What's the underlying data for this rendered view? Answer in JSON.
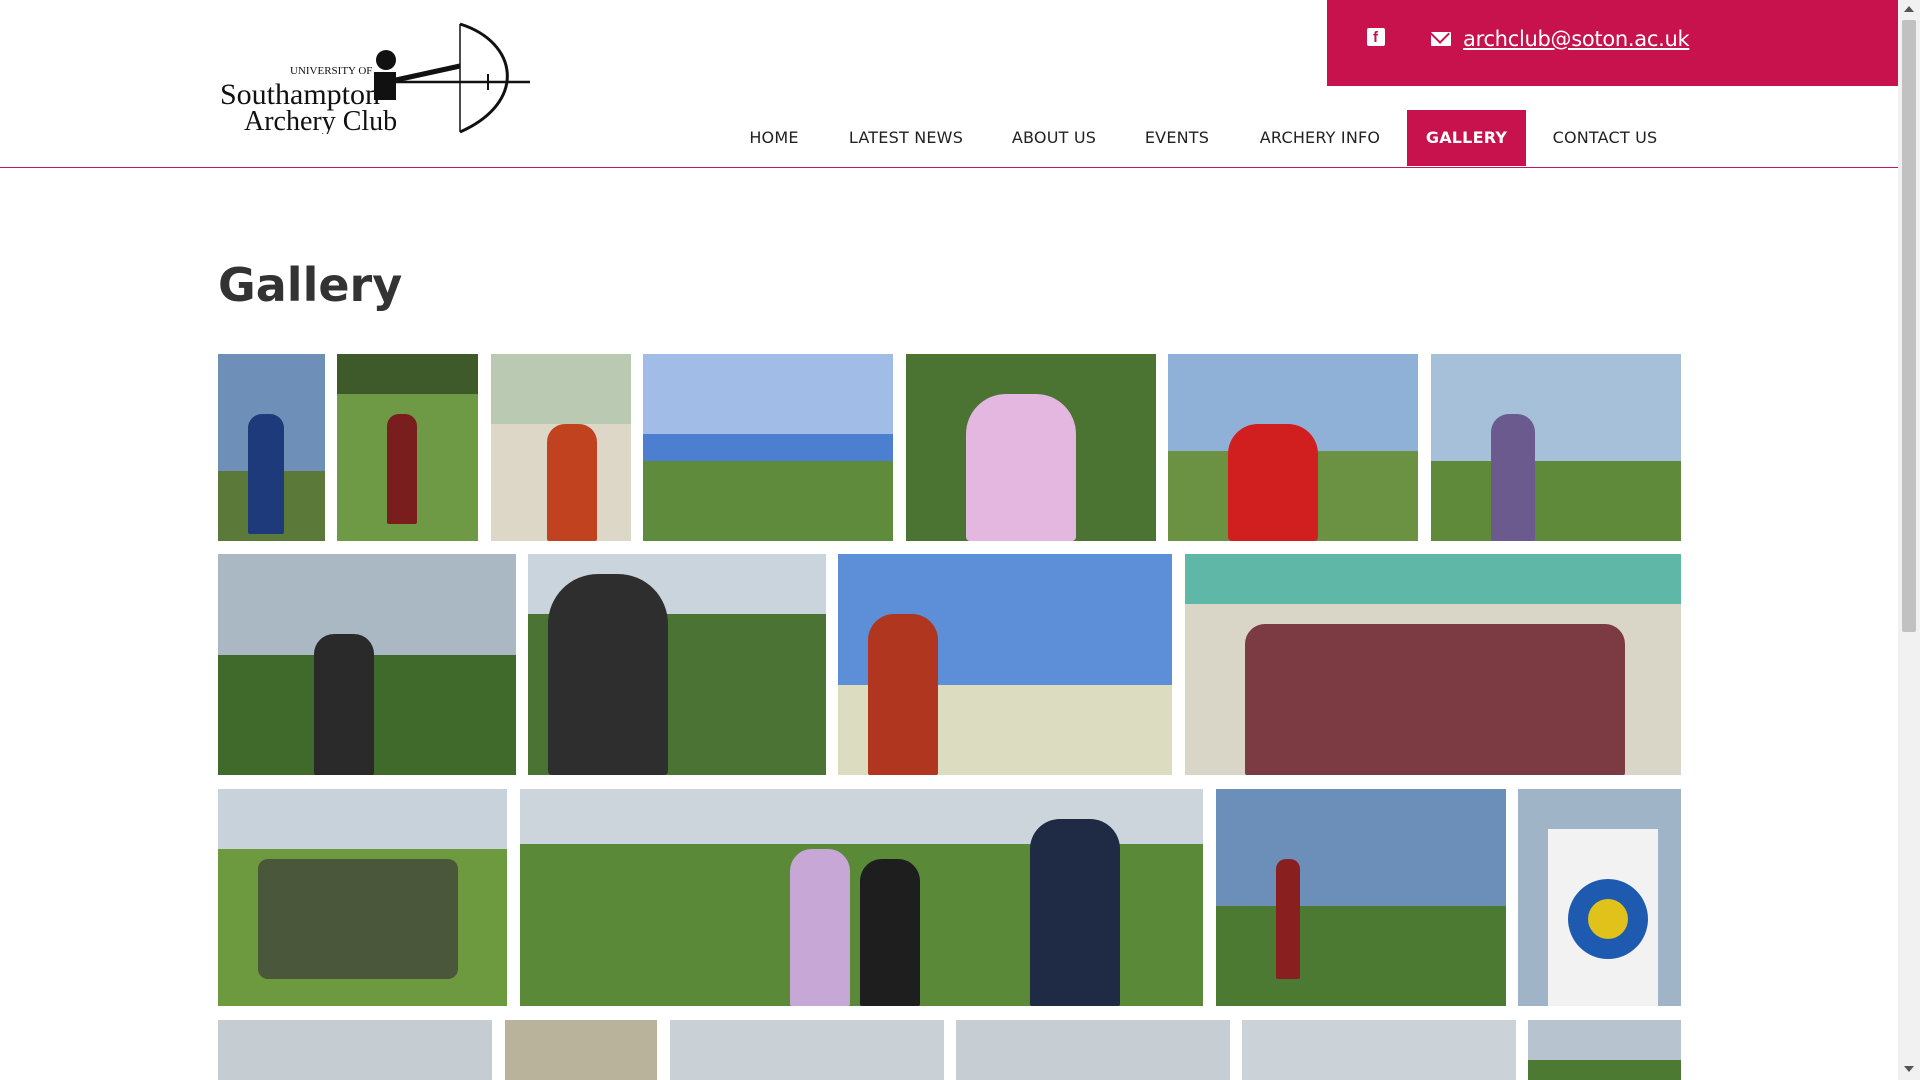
{
  "site": {
    "logo_alt": "University of Southampton Archery Club",
    "logo_line1": "UNIVERSITY OF",
    "logo_line2": "Southampton",
    "logo_line3": "Archery Club"
  },
  "topbar": {
    "facebook_icon": "facebook-icon",
    "mail_icon": "envelope-icon",
    "email": "archclub@soton.ac.uk"
  },
  "nav": {
    "items": [
      {
        "label": "HOME"
      },
      {
        "label": "LATEST NEWS"
      },
      {
        "label": "ABOUT US"
      },
      {
        "label": "EVENTS"
      },
      {
        "label": "ARCHERY INFO"
      },
      {
        "label": "GALLERY",
        "active": true
      },
      {
        "label": "CONTACT US"
      }
    ]
  },
  "page": {
    "title": "Gallery"
  },
  "colors": {
    "accent": "#c8124e",
    "nav_text": "#222222",
    "title": "#333333"
  }
}
